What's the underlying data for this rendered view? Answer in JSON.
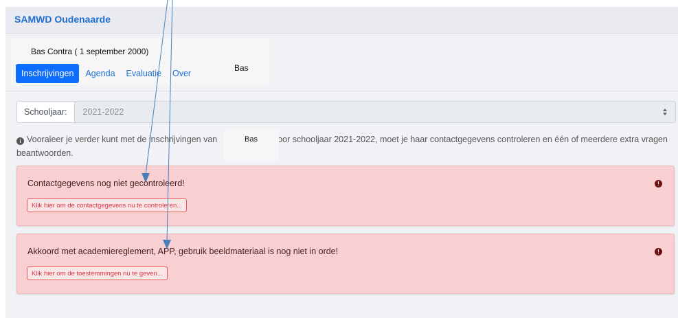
{
  "header": {
    "brand": "SAMWD Oudenaarde"
  },
  "student": {
    "name": "Bas Contra ( 1 september 2000)",
    "overlay_name_top": "Bas",
    "overlay_name_info": "Bas"
  },
  "tabs": [
    {
      "label": "Inschrijvingen",
      "active": true
    },
    {
      "label": "Agenda"
    },
    {
      "label": "Evaluatie"
    },
    {
      "label": "Over"
    }
  ],
  "schoolyear": {
    "label": "Schooljaar:",
    "value": "2021-2022"
  },
  "info": {
    "text_before": "Vooraleer je verder kunt met de inschrijvingen van",
    "text_after": "oor schooljaar 2021-2022, moet je haar contactgegevens controleren en één of meerdere extra vragen beantwoorden."
  },
  "alerts": [
    {
      "title": "Contactgegevens nog niet gecontroleerd!",
      "button": "Klik hier om de contactgegevens nu te controleren..."
    },
    {
      "title": "Akkoord met academiereglement, APP, gebruik beeldmateriaal is nog niet in orde!",
      "button": "Klik hier om de toestemmingen nu te geven..."
    }
  ],
  "colors": {
    "primary": "#0d6efd",
    "brand": "#1f6fd1",
    "alert_bg": "#f8d0d2",
    "danger": "#dc3545",
    "arrow": "#4a7ebb"
  },
  "icons": {
    "info": "info-circle-icon",
    "alert": "exclamation-circle-icon",
    "caret": "select-caret-icon"
  }
}
